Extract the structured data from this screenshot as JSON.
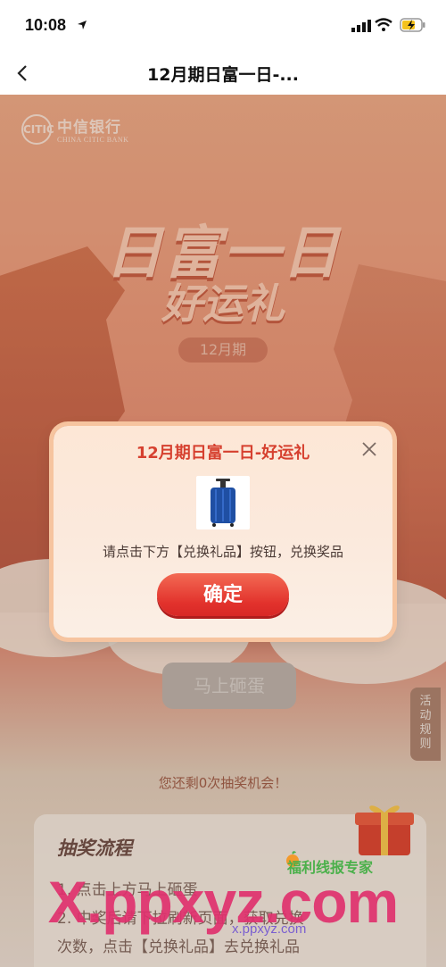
{
  "status_bar": {
    "time": "10:08"
  },
  "nav": {
    "title": "12月期日富一日-..."
  },
  "bank": {
    "name_cn": "中信银行",
    "name_en": "CHINA CITIC BANK",
    "logo_mark": "CITIC"
  },
  "campaign": {
    "headline_1": "日富一日",
    "headline_2": "好运礼",
    "period": "12月期",
    "smash_button": "马上砸蛋",
    "rules_tab": "活动规则",
    "chances_text": "您还剩0次抽奖机会！"
  },
  "flow": {
    "title": "抽奖流程",
    "steps": [
      "1. 点击上方马上砸蛋",
      "2. 中奖后请下拉刷新页面，获取兑换",
      "次数，点击【兑换礼品】去兑换礼品"
    ]
  },
  "modal": {
    "title": "12月期日富一日-好运礼",
    "message": "请点击下方【兑换礼品】按钮，兑换奖品",
    "confirm_label": "确定",
    "prize_icon": "suitcase-icon"
  },
  "watermark": {
    "main": "X.ppxyz.com",
    "sub": "x.ppxyz.com",
    "brand": "福利线报专家"
  },
  "colors": {
    "accent": "#e2322c",
    "title_red": "#d6402f",
    "watermark_pink": "#e0316e",
    "brand_green": "#4bb04b"
  }
}
